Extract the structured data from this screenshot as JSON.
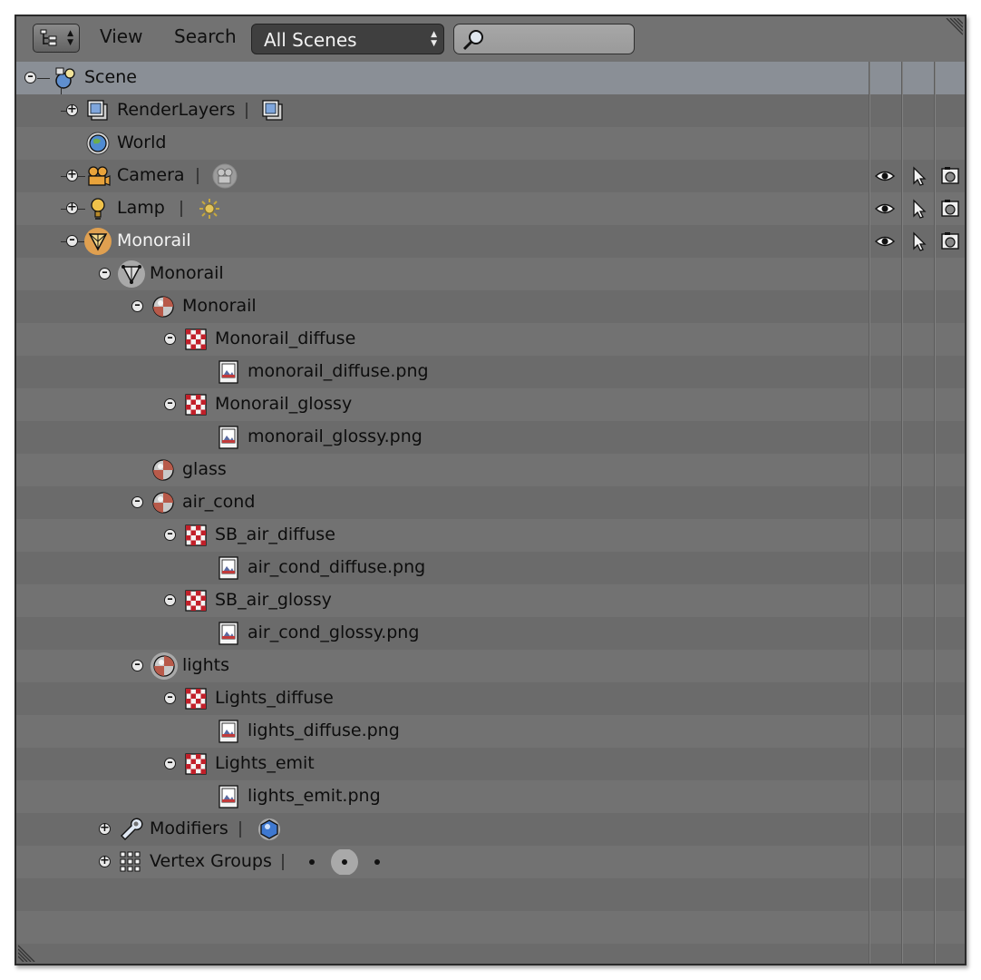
{
  "header": {
    "view_label": "View",
    "search_label": "Search",
    "scene_filter": "All Scenes",
    "search_value": ""
  },
  "tree": {
    "scene": "Scene",
    "render_layers": "RenderLayers",
    "world": "World",
    "camera": "Camera",
    "lamp": "Lamp",
    "monorail_object": "Monorail",
    "monorail_mesh": "Monorail",
    "materials": [
      {
        "name": "Monorail",
        "textures": [
          {
            "name": "Monorail_diffuse",
            "image": "monorail_diffuse.png"
          },
          {
            "name": "Monorail_glossy",
            "image": "monorail_glossy.png"
          }
        ]
      },
      {
        "name": "glass",
        "textures": []
      },
      {
        "name": "air_cond",
        "textures": [
          {
            "name": "SB_air_diffuse",
            "image": "air_cond_diffuse.png"
          },
          {
            "name": "SB_air_glossy",
            "image": "air_cond_glossy.png"
          }
        ]
      },
      {
        "name": "lights",
        "textures": [
          {
            "name": "Lights_diffuse",
            "image": "lights_diffuse.png"
          },
          {
            "name": "Lights_emit",
            "image": "lights_emit.png"
          }
        ]
      }
    ],
    "modifiers": "Modifiers",
    "vertex_groups": "Vertex Groups"
  },
  "restriction_icons": [
    "eye-icon",
    "cursor-icon",
    "camera-render-icon"
  ],
  "colors": {
    "panel_bg": "#727272",
    "row_alt": "#6b6b6b",
    "selected_row": "#8a8f96",
    "active_highlight": "#e0a050"
  }
}
